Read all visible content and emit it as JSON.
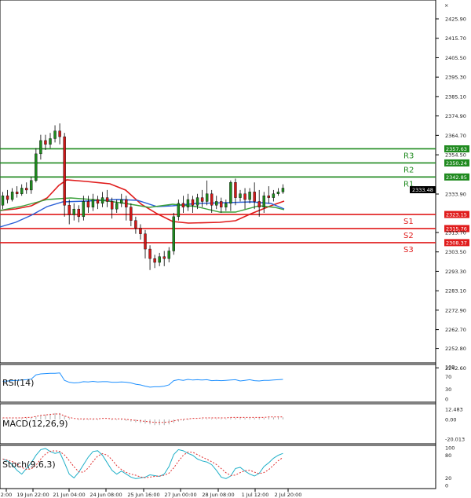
{
  "price_axis": {
    "ticks": [
      "2425.90",
      "2415.70",
      "2405.50",
      "2395.30",
      "2385.10",
      "2374.90",
      "2364.70",
      "2354.50",
      "2333.90",
      "2313.70",
      "2303.50",
      "2293.30",
      "2283.10",
      "2272.90",
      "2262.70",
      "2252.80",
      "2242.60"
    ],
    "current_price": "2333.48"
  },
  "levels": [
    {
      "name": "R3",
      "value": "2357.63",
      "color": "#1f8a1f"
    },
    {
      "name": "R2",
      "value": "2350.24",
      "color": "#1f8a1f"
    },
    {
      "name": "R1",
      "value": "2342.85",
      "color": "#1f8a1f"
    },
    {
      "name": "S1",
      "value": "2323.15",
      "color": "#e01c1c"
    },
    {
      "name": "S2",
      "value": "2315.76",
      "color": "#e01c1c"
    },
    {
      "name": "S3",
      "value": "2308.37",
      "color": "#e01c1c"
    }
  ],
  "time_axis": [
    "2:00",
    "19 Jun 22:00",
    "21 Jun 04:00",
    "24 Jun 08:00",
    "25 Jun 16:00",
    "27 Jun 00:00",
    "28 Jun 08:00",
    "1 Jul 12:00",
    "2 Jul 20:00"
  ],
  "panels": {
    "rsi": {
      "label": "RSI(14)",
      "ticks": [
        "100",
        "70",
        "30",
        "0"
      ]
    },
    "macd": {
      "label": "MACD(12,26,9)",
      "ticks": [
        "12.483",
        "0.00",
        "-20.013"
      ]
    },
    "stoch": {
      "label": "Stoch(9,6,3)",
      "ticks": [
        "100",
        "80",
        "20",
        "0"
      ]
    }
  },
  "colors": {
    "bull": "#1f8a1f",
    "bear": "#d01818",
    "ma_red": "#e01c1c",
    "ma_blue": "#2a5fd6",
    "ma_green": "#3aa03a",
    "rsi_line": "#1e90ff",
    "macd_dash": "#e03030",
    "stoch_k": "#20b0c8",
    "stoch_d": "#e03030"
  }
}
